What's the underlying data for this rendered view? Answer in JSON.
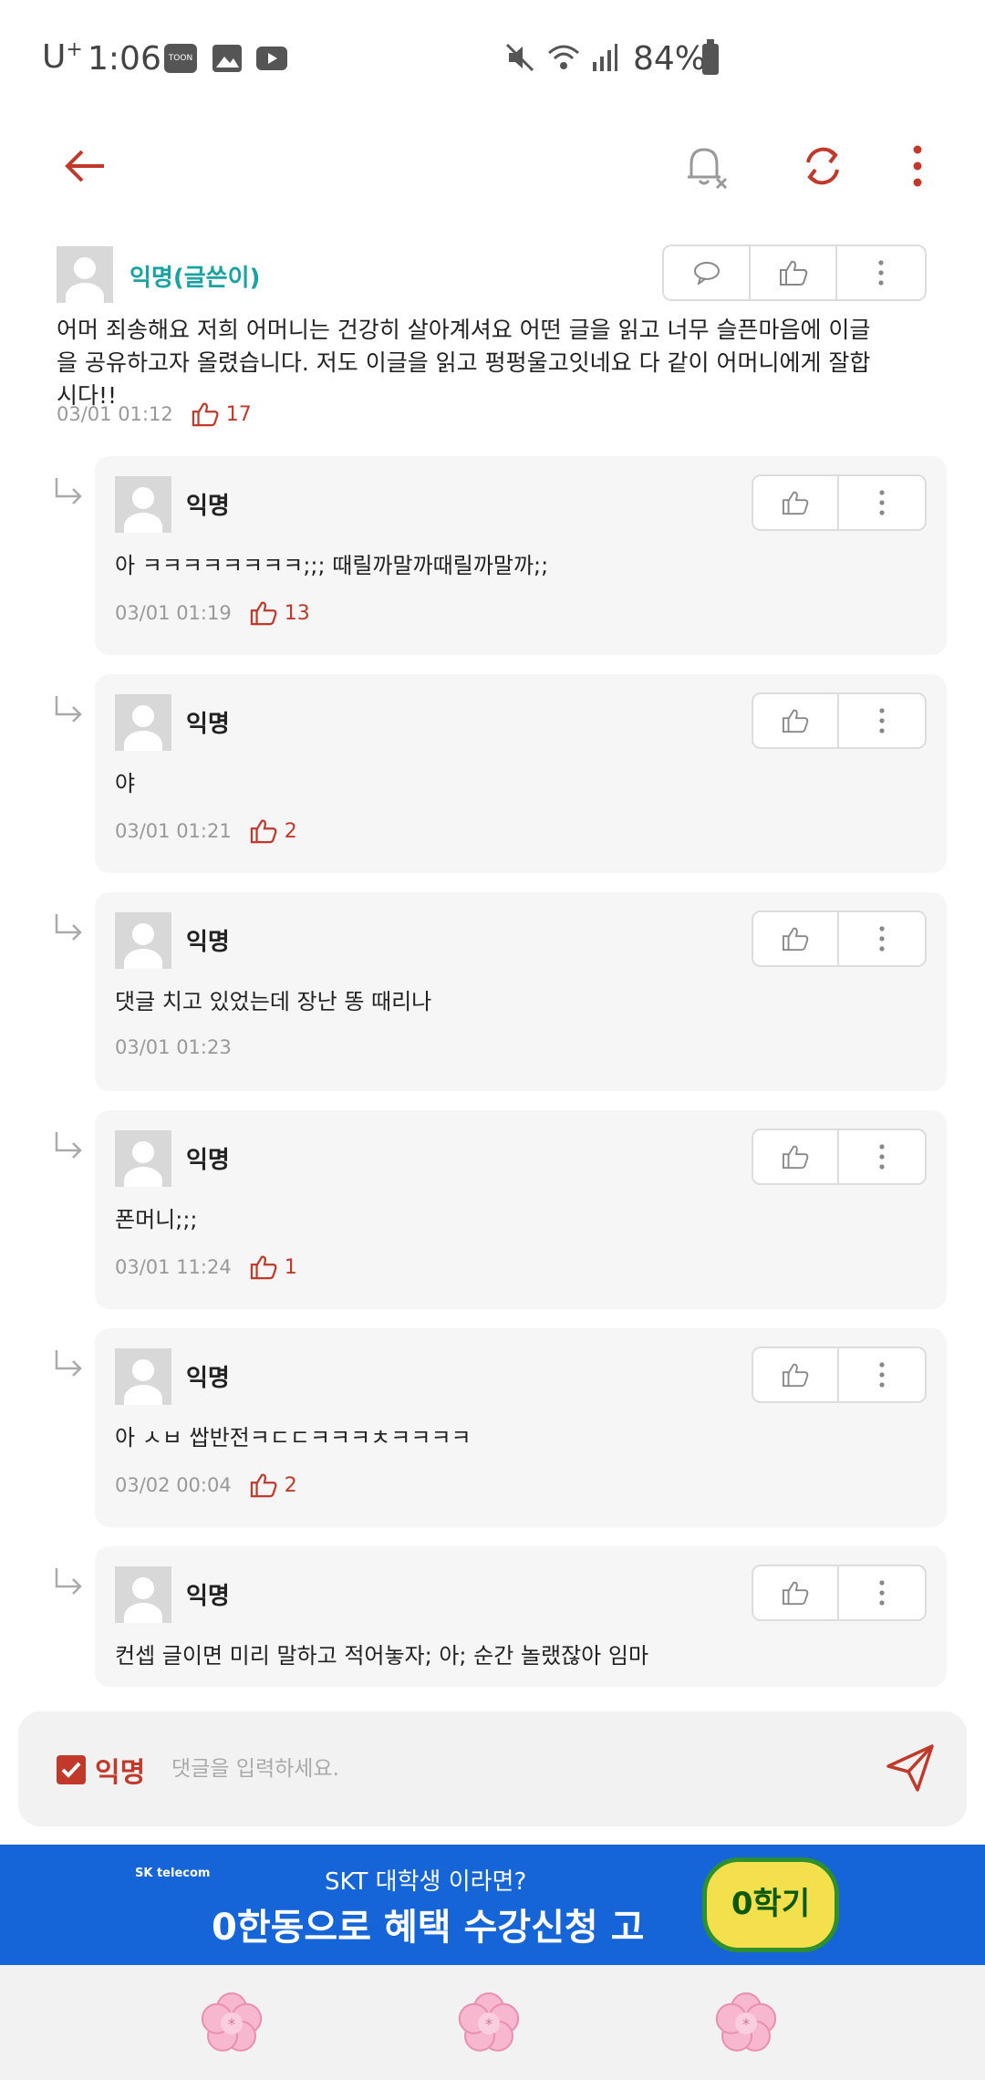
{
  "status_bar": {
    "carrier": "U",
    "carrier_sup": "+",
    "time": "1:06",
    "app_icon_1": "webtoon-icon",
    "app_icon_2": "gallery-icon",
    "app_icon_3": "youtube-icon",
    "battery": "84%"
  },
  "app_bar": {
    "back_icon": "arrow-left-icon",
    "notify_icon": "bell-off-icon",
    "refresh_icon": "refresh-icon",
    "more_icon": "more-vertical-icon",
    "accent": "#c0392b"
  },
  "post": {
    "author": "익명(글쓴이)",
    "body": "어머 죄송해요 저희 어머니는 건강히 살아계셔요 어떤 글을 읽고 너무 슬픈마음에 이글을 공유하고자 올렸습니다. 저도 이글을 읽고 펑펑울고잇네요 다 같이 어머니에게 잘합시다!!",
    "time": "03/01 01:12",
    "likes": "17"
  },
  "replies": [
    {
      "author": "익명",
      "text": "아 ㅋㅋㅋㅋㅋㅋㅋㅋ;;; 때릴까말까때릴까말까;;",
      "time": "03/01 01:19",
      "likes": "13"
    },
    {
      "author": "익명",
      "text": "야",
      "time": "03/01 01:21",
      "likes": "2"
    },
    {
      "author": "익명",
      "text": "댓글 치고 있었는데 장난 똥 때리나",
      "time": "03/01 01:23",
      "likes": ""
    },
    {
      "author": "익명",
      "text": "폰머니;;;",
      "time": "03/01 11:24",
      "likes": "1"
    },
    {
      "author": "익명",
      "text": "아 ㅅㅂ 쌉반전ㅋㄷㄷㅋㅋㅋㅊㅋㅋㅋㅋ",
      "time": "03/02 00:04",
      "likes": "2"
    },
    {
      "author": "익명",
      "text": "컨셉 글이면 미리 말하고 적어놓자; 아; 순간 놀랬잖아 임마",
      "time": "",
      "likes": ""
    }
  ],
  "comment_bar": {
    "anonymous_label": "익명",
    "placeholder": "댓글을 입력하세요.",
    "send_icon": "send-icon"
  },
  "banner": {
    "brand": "SK telecom",
    "line1": "SKT 대학생 이라면?",
    "line2": "0한동으로 혜택 수강신청 고",
    "badge": "0학기",
    "color": "#1565d8"
  },
  "bottom_nav": {
    "icons": [
      "flower-icon",
      "flower-icon",
      "flower-icon"
    ]
  }
}
